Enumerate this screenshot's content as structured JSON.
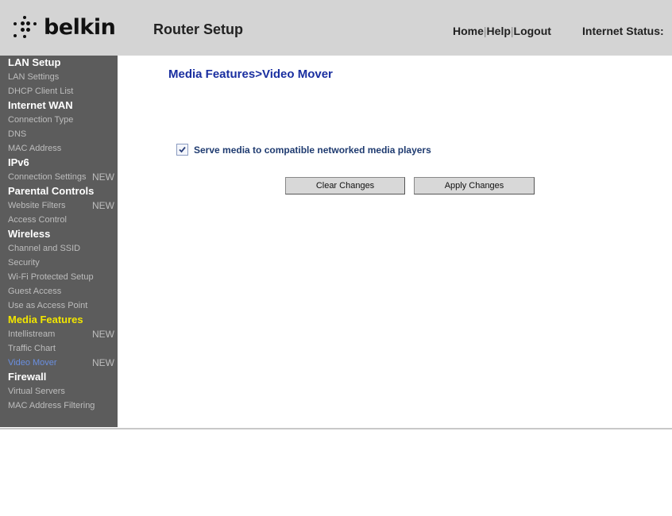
{
  "header": {
    "brand": "belkin",
    "title": "Router Setup",
    "links": [
      "Home",
      "Help",
      "Logout"
    ],
    "internet_status_label": "Internet Status:"
  },
  "sidebar": {
    "groups": [
      {
        "heading": "LAN Setup",
        "items": [
          {
            "label": "LAN Settings"
          },
          {
            "label": "DHCP Client List"
          }
        ]
      },
      {
        "heading": "Internet WAN",
        "items": [
          {
            "label": "Connection Type"
          },
          {
            "label": "DNS"
          },
          {
            "label": "MAC Address"
          }
        ]
      },
      {
        "heading": "IPv6",
        "items": [
          {
            "label": "Connection Settings",
            "badge": "NEW"
          }
        ]
      },
      {
        "heading": "Parental Controls",
        "items": [
          {
            "label": "Website Filters",
            "badge": "NEW"
          },
          {
            "label": "Access Control"
          }
        ]
      },
      {
        "heading": "Wireless",
        "items": [
          {
            "label": "Channel and SSID"
          },
          {
            "label": "Security"
          },
          {
            "label": "Wi-Fi Protected Setup"
          },
          {
            "label": "Guest Access"
          },
          {
            "label": "Use as Access Point"
          }
        ]
      },
      {
        "heading": "Media Features",
        "active": true,
        "items": [
          {
            "label": "Intellistream",
            "badge": "NEW"
          },
          {
            "label": "Traffic Chart"
          },
          {
            "label": "Video Mover",
            "badge": "NEW",
            "current": true
          }
        ]
      },
      {
        "heading": "Firewall",
        "items": [
          {
            "label": "Virtual Servers"
          },
          {
            "label": "MAC Address Filtering"
          }
        ]
      }
    ]
  },
  "main": {
    "page_title": "Media Features>Video Mover",
    "option_label": "Serve media to compatible networked media players",
    "option_checked": true,
    "clear_button": "Clear Changes",
    "apply_button": "Apply Changes"
  },
  "colors": {
    "header_bg": "#d4d4d4",
    "sidebar_bg": "#5c5c5c",
    "title_blue": "#1a2fa0",
    "active_section": "#f2e600",
    "current_item": "#6a8fe0"
  }
}
